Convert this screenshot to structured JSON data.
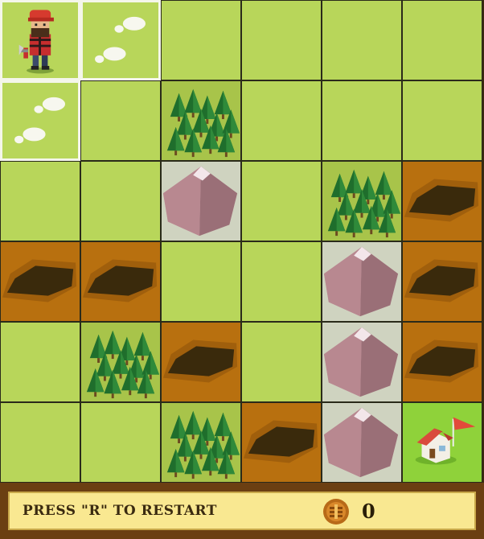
{
  "game": {
    "rows": [
      [
        "player",
        "footprint",
        "grass",
        "grass",
        "grass",
        "grass"
      ],
      [
        "footprint",
        "grass",
        "forest",
        "grass",
        "grass",
        "grass"
      ],
      [
        "grass",
        "grass",
        "mountain",
        "grass",
        "forest",
        "pit"
      ],
      [
        "pit",
        "pit",
        "grass",
        "grass",
        "mountain",
        "pit"
      ],
      [
        "grass",
        "forest",
        "pit",
        "grass",
        "mountain",
        "pit"
      ],
      [
        "grass",
        "grass",
        "forest",
        "pit",
        "mountain",
        "home"
      ]
    ]
  },
  "hud": {
    "restart_text": "PRESS \"R\" TO RESTART",
    "score": "0",
    "coin_icon": "coin-icon"
  },
  "colors": {
    "grass": "#b8d65a",
    "pit": "#b8700f",
    "mountain_bg": "#cfd3c0",
    "home_bg": "#8fd23a",
    "hud_panel": "#f9e891",
    "frame": "#6b3f12"
  }
}
